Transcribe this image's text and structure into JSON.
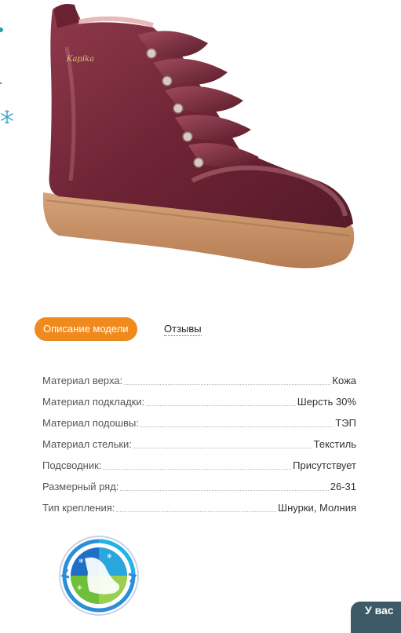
{
  "tabs": {
    "description_label": "Описание модели",
    "reviews_label": "Отзывы"
  },
  "specs": [
    {
      "name": "Материал верха:",
      "value": "Кожа"
    },
    {
      "name": "Материал подкладки:",
      "value": "Шерсть 30%"
    },
    {
      "name": "Материал подошвы:",
      "value": "ТЭП"
    },
    {
      "name": "Материал стельки:",
      "value": "Текстиль"
    },
    {
      "name": "Подсводник:",
      "value": "Присутствует"
    },
    {
      "name": "Размерный ряд:",
      "value": "26-31"
    },
    {
      "name": "Тип крепления:",
      "value": "Шнурки, Молния"
    }
  ],
  "promo": {
    "label": "У вас"
  },
  "icons": {
    "left_edge": "snowflake-icon",
    "badge": "climate-control-foot-icon"
  },
  "colors": {
    "accent": "#f08a1c",
    "boot": "#7a2a3a",
    "promo_tab": "#3e5a66"
  }
}
